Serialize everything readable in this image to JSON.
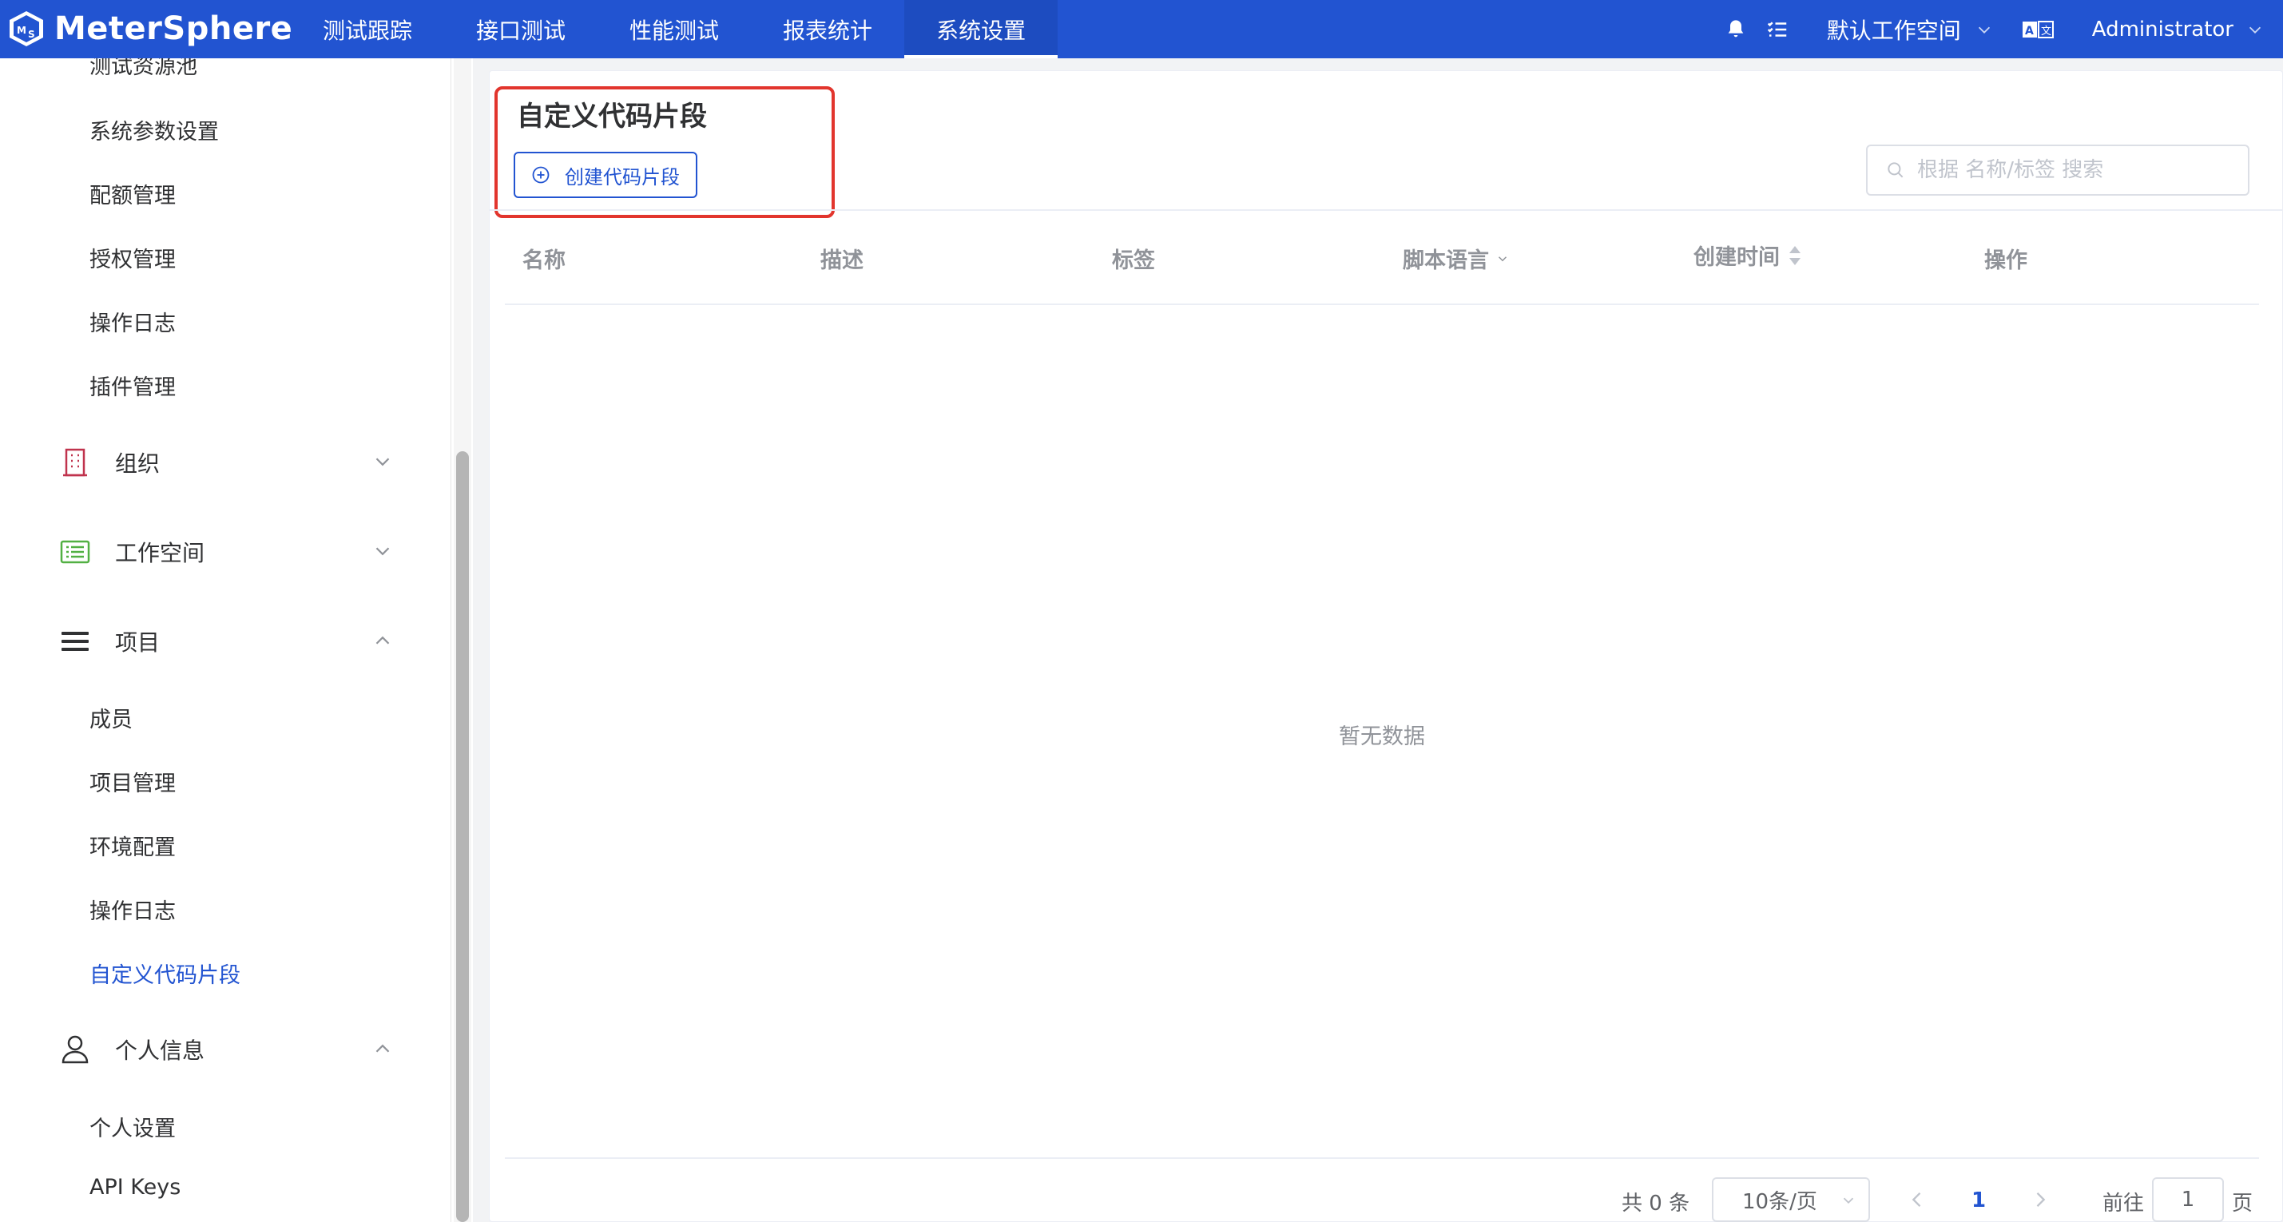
{
  "app": {
    "name": "MeterSphere",
    "brand_color": "#2254d1",
    "accent_red": "#e2352d"
  },
  "nav": {
    "items": [
      {
        "label": "测试跟踪"
      },
      {
        "label": "接口测试"
      },
      {
        "label": "性能测试"
      },
      {
        "label": "报表统计"
      },
      {
        "label": "系统设置"
      }
    ],
    "active_index": 4
  },
  "topright": {
    "icons": [
      "bell-icon",
      "task-list-icon"
    ],
    "workspace": "默认工作空间",
    "lang_icon": "translate-icon",
    "user": "Administrator"
  },
  "sidebar": {
    "system_items": [
      {
        "label": "测试资源池"
      },
      {
        "label": "系统参数设置"
      },
      {
        "label": "配额管理"
      },
      {
        "label": "授权管理"
      },
      {
        "label": "操作日志"
      },
      {
        "label": "插件管理"
      }
    ],
    "groups": {
      "org": {
        "label": "组织",
        "icon": "building-icon",
        "expanded": false
      },
      "workspace": {
        "label": "工作空间",
        "icon": "list-card-icon",
        "expanded": false
      },
      "project": {
        "label": "项目",
        "icon": "menu-icon",
        "expanded": true
      },
      "personal": {
        "label": "个人信息",
        "icon": "user-icon",
        "expanded": true
      }
    },
    "project_items": [
      {
        "label": "成员"
      },
      {
        "label": "项目管理"
      },
      {
        "label": "环境配置"
      },
      {
        "label": "操作日志"
      },
      {
        "label": "自定义代码片段"
      }
    ],
    "personal_items": [
      {
        "label": "个人设置"
      },
      {
        "label": "API Keys"
      }
    ],
    "active_item": "自定义代码片段"
  },
  "main": {
    "title": "自定义代码片段",
    "create_button": "创建代码片段",
    "search_placeholder": "根据 名称/标签 搜索",
    "columns": [
      {
        "label": "名称"
      },
      {
        "label": "描述"
      },
      {
        "label": "标签"
      },
      {
        "label": "脚本语言",
        "filter": true
      },
      {
        "label": "创建时间",
        "sortable": true
      },
      {
        "label": "操作"
      }
    ],
    "empty_text": "暂无数据"
  },
  "pagination": {
    "total": "共 0 条",
    "page_size": "10条/页",
    "current_page": "1",
    "goto_label": "前往",
    "goto_value": "1",
    "page_suffix": "页"
  }
}
